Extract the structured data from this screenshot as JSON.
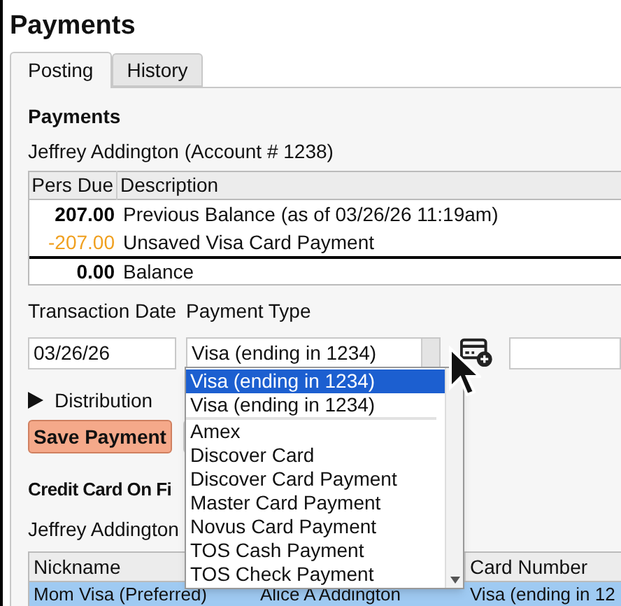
{
  "title": "Payments",
  "tabs": [
    {
      "label": "Posting",
      "selected": true
    },
    {
      "label": "History",
      "selected": false
    }
  ],
  "section_title": "Payments",
  "account_line": "Jeffrey Addington (Account # 1238)",
  "ledger": {
    "amount_header": "Pers Due",
    "description_header": "Description",
    "rows": [
      {
        "amount": "207.00",
        "description": "Previous Balance (as of 03/26/26 11:19am)",
        "kind": "balance"
      },
      {
        "amount": "-207.00",
        "description": "Unsaved Visa Card Payment",
        "kind": "pending"
      },
      {
        "amount": "0.00",
        "description": "Balance",
        "kind": "total"
      }
    ]
  },
  "form": {
    "date_label": "Transaction Date",
    "type_label": "Payment Type",
    "transaction_date": "03/26/26",
    "payment_type": "Visa (ending in 1234)"
  },
  "distribution": {
    "label": "Distribution",
    "expanded": false
  },
  "save_button": "Save Payment",
  "cards_title": "Credit Card On Fi",
  "cards_holder": "Jeffrey Addington",
  "cards_table": {
    "nickname_header": "Nickname",
    "card_number_header": "Card Number",
    "rows": [
      {
        "nickname": "Mom Visa (Preferred)",
        "holder": "Alice A Addington",
        "card_number": "Visa (ending in 12",
        "selected": true
      }
    ]
  },
  "dropdown": {
    "options": [
      {
        "label": "Visa (ending in 1234)",
        "selected": true,
        "separator_after": false
      },
      {
        "label": "Visa (ending in 1234)",
        "selected": false,
        "separator_after": true
      },
      {
        "label": "Amex",
        "selected": false,
        "separator_after": false
      },
      {
        "label": "Discover Card",
        "selected": false,
        "separator_after": false
      },
      {
        "label": "Discover Card Payment",
        "selected": false,
        "separator_after": false
      },
      {
        "label": "Master Card Payment",
        "selected": false,
        "separator_after": false
      },
      {
        "label": "Novus Card Payment",
        "selected": false,
        "separator_after": false
      },
      {
        "label": "TOS Cash Payment",
        "selected": false,
        "separator_after": false
      },
      {
        "label": "TOS Check Payment",
        "selected": false,
        "separator_after": false
      }
    ]
  }
}
